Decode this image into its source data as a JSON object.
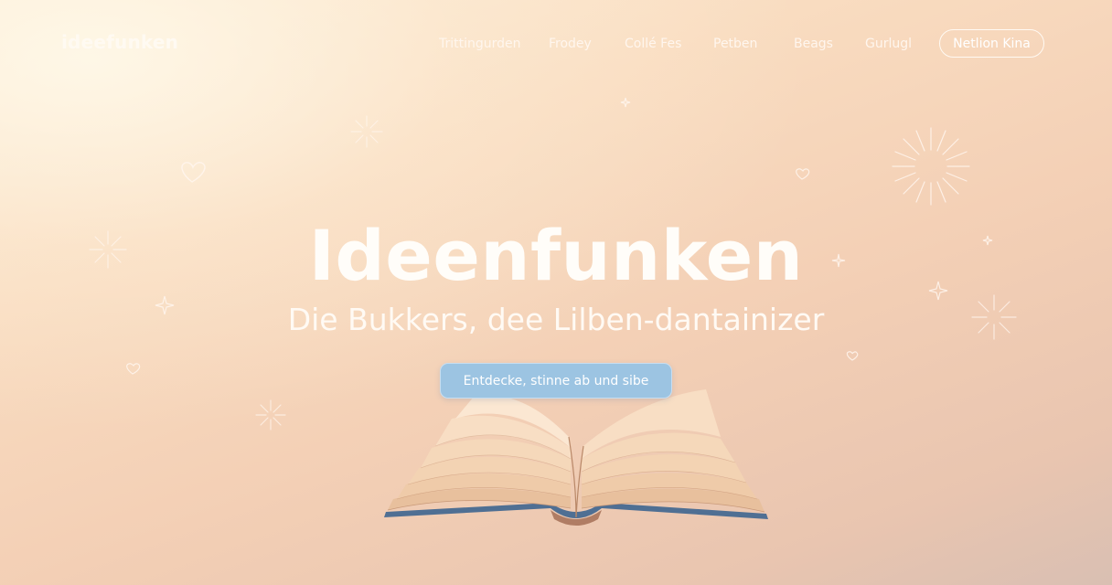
{
  "header": {
    "logo": "ideefunken",
    "nav": [
      {
        "label": "Trittingurden"
      },
      {
        "label": "Frodey"
      },
      {
        "label": "Collé Fes"
      },
      {
        "label": "Petben"
      },
      {
        "label": "Beags"
      },
      {
        "label": "Gurlugl"
      }
    ],
    "cta_label": "Netlion Kina"
  },
  "hero": {
    "title": "Ideenfunken",
    "subtitle": "Die Bukkers, dee Lilben-dantainizer",
    "cta_label": "Entdecke, stinne ab und sibe"
  },
  "icons": {
    "book": "open-book-illustration",
    "sparkle": "sparkle-icon",
    "heart": "heart-icon",
    "star": "star-icon",
    "burst": "burst-icon"
  },
  "colors": {
    "background_start": "#fcebd3",
    "background_end": "#d9bfb2",
    "cta_background": "#9cc4e2",
    "book_cover": "#4f6f93",
    "text": "#ffffff"
  }
}
